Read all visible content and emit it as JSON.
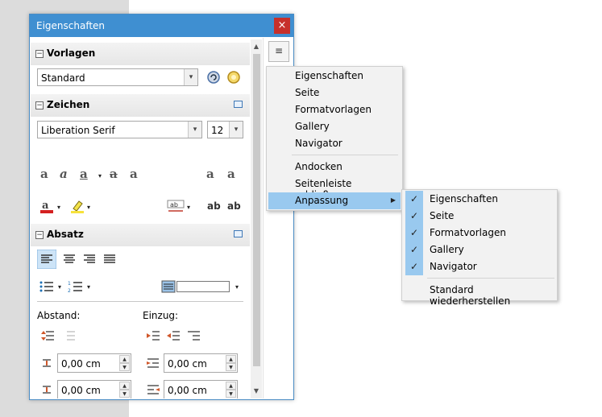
{
  "window": {
    "title": "Eigenschaften",
    "close_label": "×"
  },
  "sections": {
    "styles": {
      "title": "Vorlagen",
      "value": "Standard"
    },
    "character": {
      "title": "Zeichen",
      "font": "Liberation Serif",
      "size": "12"
    },
    "paragraph": {
      "title": "Absatz",
      "spacing_label": "Abstand:",
      "indent_label": "Einzug:",
      "fields": [
        "0,00 cm",
        "0,00 cm",
        "0,00 cm",
        "0,00 cm"
      ]
    }
  },
  "icons": {
    "expander": "⊟",
    "dropdown": "▾",
    "menu_button": "≡"
  },
  "main_menu": {
    "items": [
      "Eigenschaften",
      "Seite",
      "Formatvorlagen",
      "Gallery",
      "Navigator"
    ],
    "dock": "Andocken",
    "close_sidebar": "Seitenleiste schließen",
    "customize": "Anpassung"
  },
  "submenu": {
    "items": [
      "Eigenschaften",
      "Seite",
      "Formatvorlagen",
      "Gallery",
      "Navigator"
    ],
    "reset": "Standard wiederherstellen",
    "check": "✓"
  },
  "colors": {
    "titlebar": "#3f8fd1",
    "highlight": "#99c9ef",
    "close": "#c7302b"
  }
}
